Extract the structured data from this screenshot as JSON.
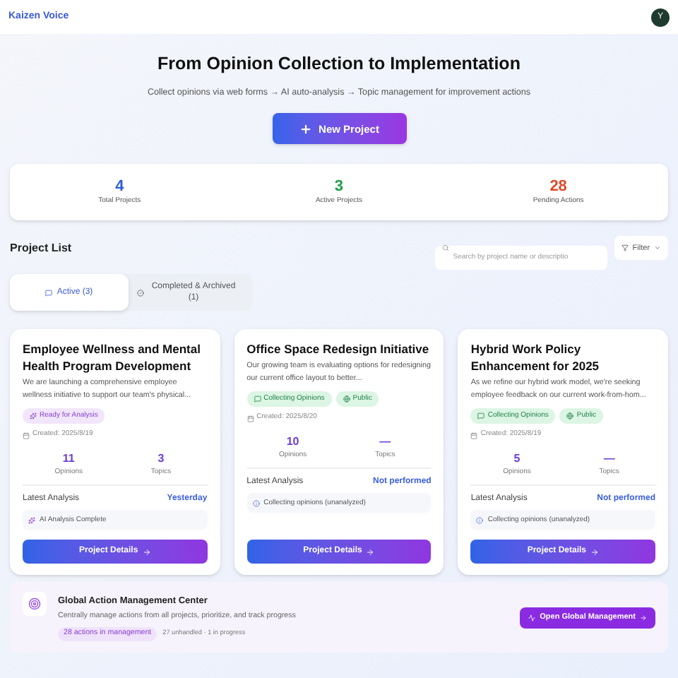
{
  "header": {
    "brand": "Kaizen Voice",
    "avatar": "Y"
  },
  "hero": {
    "title": "From Opinion Collection to Implementation",
    "subtitle": "Collect opinions via web forms → AI auto-analysis → Topic management for improvement actions",
    "button": "New Project"
  },
  "stats": [
    {
      "value": "4",
      "label": "Total Projects",
      "color": "#2f5bd8"
    },
    {
      "value": "3",
      "label": "Active Projects",
      "color": "#1f9d4b"
    },
    {
      "value": "28",
      "label": "Pending Actions",
      "color": "#e0492a"
    }
  ],
  "project_list": {
    "title": "Project List",
    "search": {
      "placeholder": "Search by project name or descriptio"
    },
    "filter": "Filter"
  },
  "tabs": [
    {
      "label": "Active (3)",
      "selected": true,
      "kind": "active"
    },
    {
      "label": "Completed & Archived (1)",
      "selected": false,
      "kind": "completed"
    }
  ],
  "projects": [
    {
      "title": "Employee Wellness and Mental Health Program Development",
      "description": "We are launching a comprehensive employee wellness initiative to support our team's physical...",
      "badges": [
        {
          "label": "Ready for Analysis",
          "kind": "ready"
        }
      ],
      "created": "Created: 2025/8/19",
      "opinions": "11",
      "opinions_label": "Opinions",
      "topics": "3",
      "topics_label": "Topics",
      "analysis_label": "Latest Analysis",
      "analysis_value": "Yesterday",
      "status": {
        "text": "AI Analysis Complete",
        "kind": "done"
      },
      "button": "Project Details"
    },
    {
      "title": "Office Space Redesign Initiative",
      "description": "Our growing team is evaluating options for redesigning our current office layout to better...",
      "badges": [
        {
          "label": "Collecting Opinions",
          "kind": "collecting"
        },
        {
          "label": "Public",
          "kind": "public"
        }
      ],
      "created": "Created: 2025/8/20",
      "opinions": "10",
      "opinions_label": "Opinions",
      "topics": "—",
      "topics_label": "Topics",
      "analysis_label": "Latest Analysis",
      "analysis_value": "Not performed",
      "status": {
        "text": "Collecting opinions (unanalyzed)",
        "kind": "pending"
      },
      "button": "Project Details"
    },
    {
      "title": "Hybrid Work Policy Enhancement for 2025",
      "description": "As we refine our hybrid work model, we're seeking employee feedback on our current work-from-hom...",
      "badges": [
        {
          "label": "Collecting Opinions",
          "kind": "collecting"
        },
        {
          "label": "Public",
          "kind": "public"
        }
      ],
      "created": "Created: 2025/8/19",
      "opinions": "5",
      "opinions_label": "Opinions",
      "topics": "—",
      "topics_label": "Topics",
      "analysis_label": "Latest Analysis",
      "analysis_value": "Not performed",
      "status": {
        "text": "Collecting opinions (unanalyzed)",
        "kind": "pending"
      },
      "button": "Project Details"
    }
  ],
  "action_center": {
    "title": "Global Action Management Center",
    "description": "Centrally manage actions from all projects, prioritize, and track progress",
    "badge": "28 actions in management",
    "summary": "27 unhandled · 1 in progress",
    "button": "Open Global Management"
  }
}
